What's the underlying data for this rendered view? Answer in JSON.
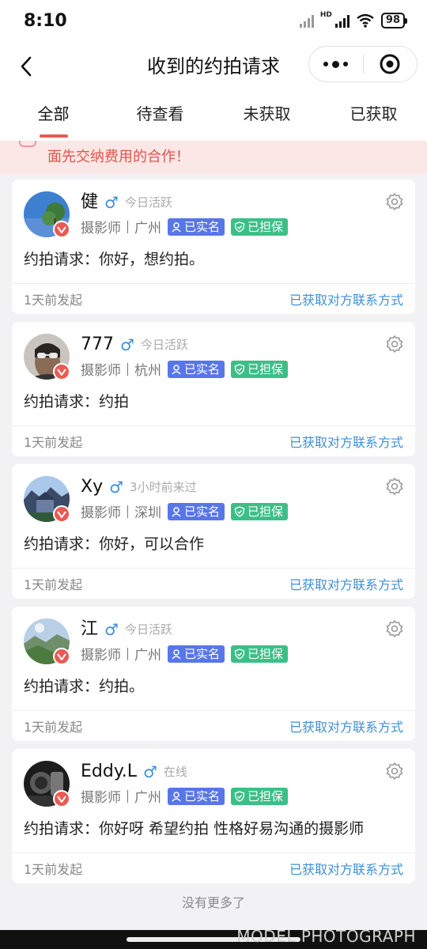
{
  "status": {
    "time": "8:10",
    "network": "HD",
    "battery": "98"
  },
  "nav": {
    "title": "收到的约拍请求"
  },
  "tabs": [
    {
      "label": "全部",
      "active": true
    },
    {
      "label": "待查看",
      "active": false
    },
    {
      "label": "未获取",
      "active": false
    },
    {
      "label": "已获取",
      "active": false
    }
  ],
  "notice": {
    "text": "面先交纳费用的合作！"
  },
  "labels": {
    "verified": "已实名",
    "guaranteed": "已担保",
    "request_prefix": "约拍请求：",
    "contact_status": "已获取对方联系方式"
  },
  "cards": [
    {
      "name": "健",
      "gender": "♂",
      "activity": "今日活跃",
      "role": "摄影师",
      "city": "广州",
      "request": "你好，想约拍。",
      "time": "1天前发起"
    },
    {
      "name": "777",
      "gender": "♂",
      "activity": "今日活跃",
      "role": "摄影师",
      "city": "杭州",
      "request": "约拍",
      "time": "1天前发起"
    },
    {
      "name": "Xy",
      "gender": "♂",
      "activity": "3小时前来过",
      "role": "摄影师",
      "city": "深圳",
      "request": "你好，可以合作",
      "time": "1天前发起"
    },
    {
      "name": "江",
      "gender": "♂",
      "activity": "今日活跃",
      "role": "摄影师",
      "city": "广州",
      "request": "约拍。",
      "time": "1天前发起"
    },
    {
      "name": "Eddy.L",
      "gender": "♂",
      "activity": "在线",
      "role": "摄影师",
      "city": "广州",
      "request": "你好呀 希望约拍 性格好易沟通的摄影师",
      "time": "1天前发起"
    }
  ],
  "footer": {
    "no_more": "没有更多了",
    "watermark": "MODEL PHOTOGRAPH"
  },
  "colors": {
    "accent": "#e85a55",
    "link": "#3f8fd5",
    "verified": "#5876e8",
    "guaranteed": "#3cbf87",
    "gender": "#3a8ee0"
  }
}
